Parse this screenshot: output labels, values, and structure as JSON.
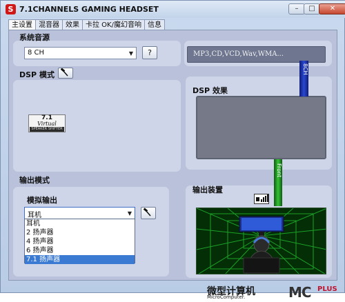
{
  "window": {
    "title": "7.1CHANNELS GAMING HEADSET",
    "app_icon_letter": "S",
    "minimize": "–",
    "maximize": "□",
    "close": "✕"
  },
  "tabs": [
    "主设置",
    "混音器",
    "效果",
    "卡拉 OK/魔幻音响",
    "信息"
  ],
  "system_source": {
    "label": "系统音源",
    "combo_value": "8 CH",
    "help_button": "?",
    "formats": "MP3,CD,VCD,Wav,WMA..."
  },
  "dsp_mode": {
    "label": "DSP 模式",
    "logo_line1": "7.1",
    "logo_line2": "Virtual",
    "logo_line3": "SPEAKER SHIFTER"
  },
  "dsp_effect": {
    "label": "DSP 效果"
  },
  "indicators": {
    "bar_8ch": "8CH",
    "bar_front": "Front"
  },
  "output_mode": {
    "label": "输出模式",
    "analog_label": "模拟输出",
    "combo_value": "耳机",
    "options": [
      "耳机",
      "2 扬声器",
      "4 扬声器",
      "6 扬声器",
      "7.1 扬声器"
    ],
    "highlighted_option": "7.1 扬声器"
  },
  "output_device": {
    "label": "输出装置"
  },
  "watermark": {
    "title": "微型计算机",
    "subtitle": "MicroComputer.",
    "brand": "MC",
    "plus": "PLUS"
  },
  "colors": {
    "panel": "#cfd5e9",
    "client": "#bac2db",
    "selection": "#3a7ad2",
    "bar_8ch": "#2b48d0",
    "bar_front": "#36c236",
    "scene_grid": "#1fae2c"
  }
}
